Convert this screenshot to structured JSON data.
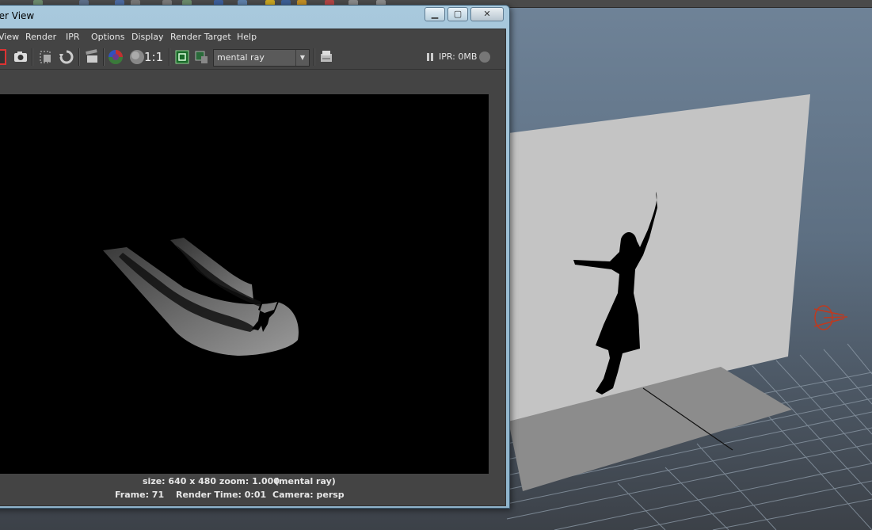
{
  "window": {
    "title": "der View",
    "minimize_glyph": "▁",
    "maximize_glyph": "▢",
    "close_glyph": "✕"
  },
  "menu": {
    "items": [
      "View",
      "Render",
      "IPR",
      "Options",
      "Display",
      "Render Target",
      "Help"
    ]
  },
  "toolbar": {
    "icons": [
      "redo-render-icon",
      "snapshot-icon",
      "render-region-icon",
      "refresh-icon",
      "clapper-icon",
      "rgb-channels-icon",
      "alpha-channel-icon",
      "one-to-one-icon",
      "keep-image-icon",
      "remove-image-icon",
      "settings-icon"
    ],
    "zoom_label": "1:1",
    "renderer": "mental ray",
    "ipr_status": "IPR: 0MB"
  },
  "status": {
    "size_line": "size: 640 x 480 zoom: 1.000",
    "renderer_note": "(mental ray)",
    "frame": "Frame: 71",
    "render_time": "Render Time: 0:01",
    "camera": "Camera: persp"
  },
  "colors": {
    "window_frame": "#8fb4cb",
    "panel": "#444444",
    "viewport_top": "#6f8398",
    "wall": "#c4c4c4",
    "floor": "#8c8c8c",
    "light_gizmo": "#c0391e"
  }
}
